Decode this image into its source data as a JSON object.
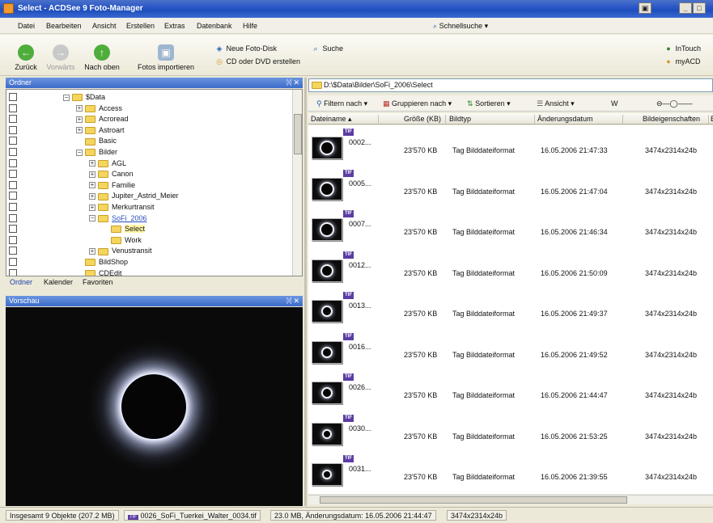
{
  "window": {
    "title": "Select - ACDSee 9 Foto-Manager"
  },
  "menu": {
    "items": [
      "Datei",
      "Bearbeiten",
      "Ansicht",
      "Erstellen",
      "Extras",
      "Datenbank",
      "Hilfe"
    ],
    "quicksearch": "Schnellsuche"
  },
  "toolbar": {
    "back": "Zurück",
    "forward": "Vorwärts",
    "up": "Nach oben",
    "import": "Fotos importieren",
    "new_disk": "Neue Foto-Disk",
    "cd_dvd": "CD oder DVD erstellen",
    "search": "Suche",
    "intouch": "InTouch",
    "myacd": "myACD"
  },
  "folder_panel": {
    "title": "Ordner",
    "tree": [
      {
        "label": "$Data",
        "indent": 0,
        "exp": "−"
      },
      {
        "label": "Access",
        "indent": 1,
        "exp": "+"
      },
      {
        "label": "Acroread",
        "indent": 1,
        "exp": "+"
      },
      {
        "label": "Astroart",
        "indent": 1,
        "exp": "+"
      },
      {
        "label": "Basic",
        "indent": 1,
        "exp": ""
      },
      {
        "label": "Bilder",
        "indent": 1,
        "exp": "−"
      },
      {
        "label": "AGL",
        "indent": 2,
        "exp": "+"
      },
      {
        "label": "Canon",
        "indent": 2,
        "exp": "+"
      },
      {
        "label": "Familie",
        "indent": 2,
        "exp": "+"
      },
      {
        "label": "Jupiter_Astrid_Meier",
        "indent": 2,
        "exp": "+"
      },
      {
        "label": "Merkurtransit",
        "indent": 2,
        "exp": "+"
      },
      {
        "label": "SoFi_2006",
        "indent": 2,
        "exp": "−",
        "link": true
      },
      {
        "label": "Select",
        "indent": 3,
        "exp": "",
        "selected": true
      },
      {
        "label": "Work",
        "indent": 3,
        "exp": ""
      },
      {
        "label": "Venustransit",
        "indent": 2,
        "exp": "+"
      },
      {
        "label": "BildShop",
        "indent": 1,
        "exp": ""
      },
      {
        "label": "CDEdit",
        "indent": 1,
        "exp": ""
      }
    ],
    "tabs": [
      "Ordner",
      "Kalender",
      "Favoriten"
    ]
  },
  "preview_panel": {
    "title": "Vorschau"
  },
  "file_list": {
    "path": "D:\\$Data\\Bilder\\SoFi_2006\\Select",
    "toolbar": {
      "filter": "Filtern nach",
      "group": "Gruppieren nach",
      "sort": "Sortieren",
      "view": "Ansicht",
      "w": "W"
    },
    "columns": [
      "Dateiname",
      "Größe (KB)",
      "Bildtyp",
      "Änderungsdatum",
      "Bildeigenschaften",
      "B"
    ],
    "rows": [
      {
        "name": "0002...",
        "size": "23'570 KB",
        "type": "Tag Bilddateiformat",
        "date": "16.05.2006 21:47:33",
        "props": "3474x2314x24b"
      },
      {
        "name": "0005...",
        "size": "23'570 KB",
        "type": "Tag Bilddateiformat",
        "date": "16.05.2006 21:47:04",
        "props": "3474x2314x24b"
      },
      {
        "name": "0007...",
        "size": "23'570 KB",
        "type": "Tag Bilddateiformat",
        "date": "16.05.2006 21:46:34",
        "props": "3474x2314x24b"
      },
      {
        "name": "0012...",
        "size": "23'570 KB",
        "type": "Tag Bilddateiformat",
        "date": "16.05.2006 21:50:09",
        "props": "3474x2314x24b"
      },
      {
        "name": "0013...",
        "size": "23'570 KB",
        "type": "Tag Bilddateiformat",
        "date": "16.05.2006 21:49:37",
        "props": "3474x2314x24b"
      },
      {
        "name": "0016...",
        "size": "23'570 KB",
        "type": "Tag Bilddateiformat",
        "date": "16.05.2006 21:49:52",
        "props": "3474x2314x24b"
      },
      {
        "name": "0026...",
        "size": "23'570 KB",
        "type": "Tag Bilddateiformat",
        "date": "16.05.2006 21:44:47",
        "props": "3474x2314x24b"
      },
      {
        "name": "0030...",
        "size": "23'570 KB",
        "type": "Tag Bilddateiformat",
        "date": "16.05.2006 21:53:25",
        "props": "3474x2314x24b"
      },
      {
        "name": "0031...",
        "size": "23'570 KB",
        "type": "Tag Bilddateiformat",
        "date": "16.05.2006 21:39:55",
        "props": "3474x2314x24b"
      }
    ]
  },
  "status": {
    "total": "Insgesamt 9 Objekte (207.2 MB)",
    "file": "0026_SoFi_Tuerkei_Walter_0034.tif",
    "info": "23.0 MB, Änderungsdatum: 16.05.2006 21:44:47",
    "dims": "3474x2314x24b"
  },
  "icons": {
    "back": "back-arrow-icon",
    "forward": "forward-arrow-icon",
    "up": "up-arrow-icon",
    "import": "camera-import-icon",
    "disk": "disk-icon",
    "cd": "cd-icon",
    "search": "search-icon",
    "folder": "folder-icon",
    "tif": "tif-badge-icon"
  },
  "colors": {
    "titlebar": "#2a56c6",
    "panel_header": "#3c6bc9",
    "folder": "#f4d55e",
    "selection": "#fff6a8"
  }
}
